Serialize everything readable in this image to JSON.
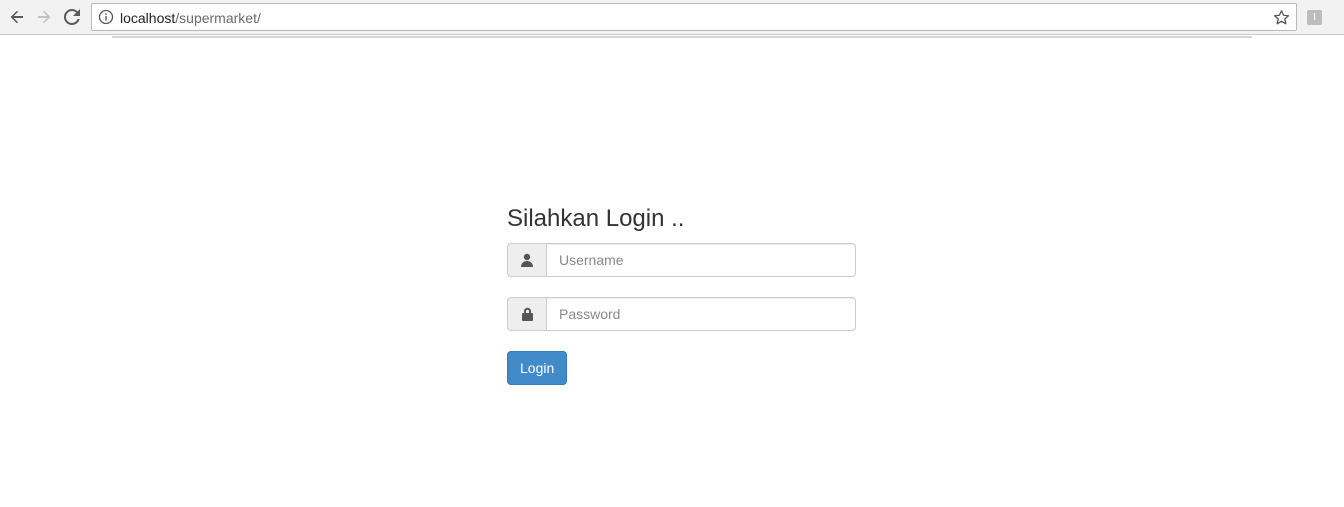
{
  "browser": {
    "url_host": "localhost",
    "url_path": "/supermarket/",
    "back_icon": "arrow-left-icon",
    "forward_icon": "arrow-right-icon",
    "reload_icon": "reload-icon",
    "info_icon": "info-icon",
    "bookmark_icon": "star-icon",
    "extension_label": "I"
  },
  "login": {
    "title": "Silahkan Login ..",
    "username_placeholder": "Username",
    "username_value": "",
    "username_icon": "user-icon",
    "password_placeholder": "Password",
    "password_value": "",
    "password_icon": "lock-icon",
    "button_label": "Login"
  },
  "colors": {
    "button_bg": "#428bca",
    "addon_bg": "#eeeeee",
    "title_text": "#333333"
  }
}
